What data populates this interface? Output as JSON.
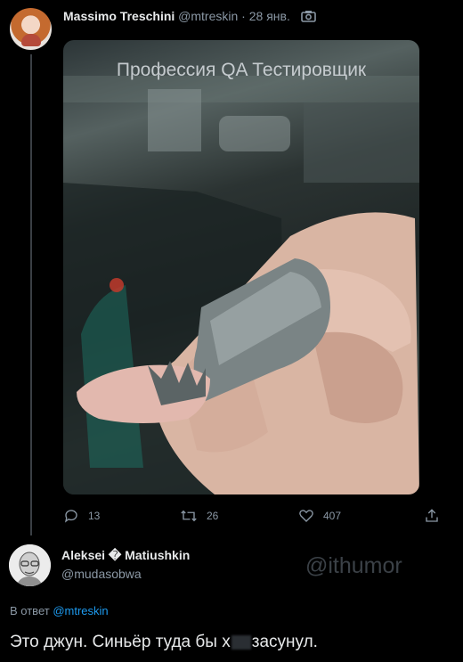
{
  "tweet": {
    "author_name": "Massimo Treschini",
    "author_handle": "@mtreskin",
    "separator": "·",
    "date": "28 янв.",
    "media_icon": "camera-icon",
    "media_caption": "Профессия QA Тестировщик",
    "actions": {
      "reply_count": "13",
      "retweet_count": "26",
      "like_count": "407"
    }
  },
  "reply": {
    "author_name": "Aleksei � Matiushkin",
    "author_handle": "@mudasobwa",
    "watermark": "@ithumor",
    "reply_prefix": "В ответ",
    "reply_to": "@mtreskin",
    "text_before": "Это джун. Синьёр туда бы х",
    "text_after": "засунул."
  },
  "colors": {
    "background": "#000000",
    "text": "#e7e9ea",
    "muted": "#8b98a5",
    "link": "#1d9bf0"
  }
}
